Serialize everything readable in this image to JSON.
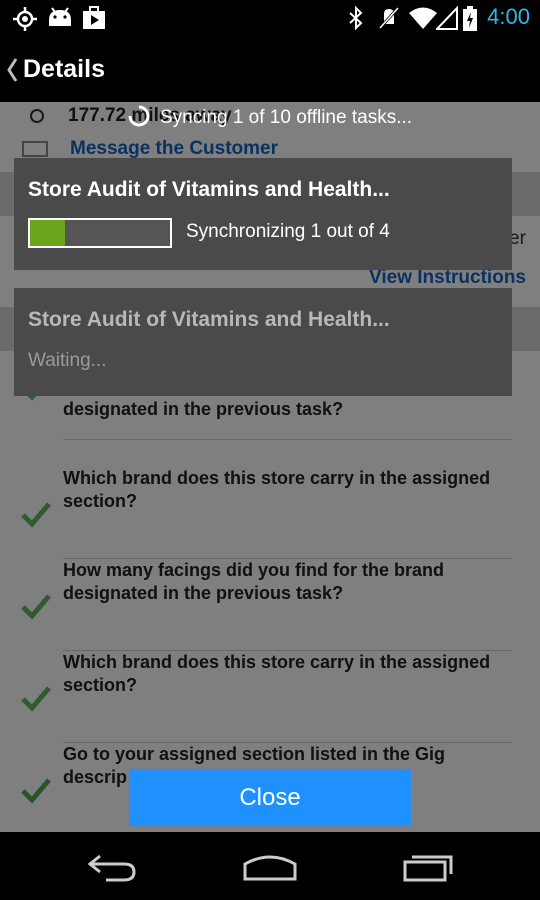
{
  "status_bar": {
    "time": "4:00",
    "left_icons": [
      "gps-icon",
      "android-icon",
      "media-icon"
    ],
    "right_icons": [
      "bluetooth-icon",
      "mute-icon",
      "wifi-icon",
      "signal-icon",
      "battery-icon"
    ],
    "accent_color": "#33b5e5"
  },
  "action_bar": {
    "title": "Details"
  },
  "content": {
    "distance": "177.72 miles away",
    "message_link": "Message the Customer",
    "view_instructions": "View Instructions",
    "cut_text": "er",
    "tasks": [
      {
        "question": "designated in the previous task?"
      },
      {
        "question": "Which brand does this store carry in the assigned section?"
      },
      {
        "question": "How many facings did you find for the brand designated in the previous task?"
      },
      {
        "question": "Which brand does this store carry in the assigned section?"
      },
      {
        "question": "Go to your assigned section listed in the Gig descrip"
      }
    ]
  },
  "sync": {
    "header": "Syncing 1 of 10 offline tasks...",
    "dialogs": [
      {
        "title": "Store Audit of Vitamins and Health...",
        "status": "Synchronizing 1 out of 4",
        "progress": 0.25
      },
      {
        "title": "Store Audit of Vitamins and Health...",
        "status": "Waiting..."
      }
    ],
    "close_label": "Close"
  },
  "colors": {
    "progress": "#6aa51b",
    "close_button": "#1e90ff",
    "link": "#1565c0"
  }
}
